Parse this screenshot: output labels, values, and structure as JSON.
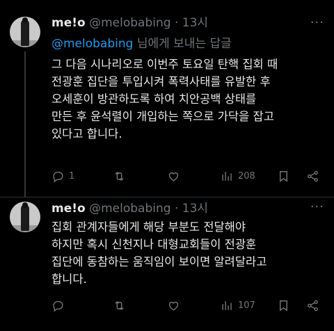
{
  "tweets": [
    {
      "name": "me!o",
      "handle": "@melobabing",
      "dot": "·",
      "time": "13시",
      "reply_to_handle": "@melobabing",
      "reply_to_suffix": " 님에게 보내는 답글",
      "lines": [
        "그 다음 시나리오로 이번주 토요일 탄핵 집회 때",
        "전광훈 집단을 투입시켜 폭력사태를 유발한 후",
        "오세훈이 방관하도록 하여 치안공백 상태를",
        "만든 후 윤석렬이 개입하는 쪽으로 가닥을 잡고",
        "있다고 합니다."
      ],
      "replies": "1",
      "views": "208",
      "more": "···"
    },
    {
      "name": "me!o",
      "handle": "@melobabing",
      "dot": "·",
      "time": "13시",
      "lines": [
        "집회 관계자들에게 해당 부분도 전달해야",
        "하지만 혹시 신천지나 대형교회들이 전광훈",
        "집단에 동참하는 움직임이 보이면 알려달라고",
        "합니다."
      ],
      "views": "107",
      "more": "···"
    }
  ],
  "icons": [
    "avatar",
    "more-icon",
    "reply-icon",
    "retweet-icon",
    "like-icon",
    "views-icon",
    "bookmark-icon",
    "share-icon"
  ]
}
